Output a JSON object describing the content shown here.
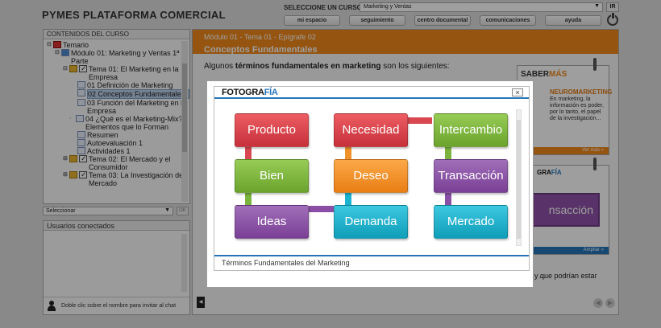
{
  "app": {
    "title": "PYMES PLATAFORMA COMERCIAL",
    "course_select_label": "SELECCIONE UN CURSO:",
    "course_selected": "Marketing y Ventas",
    "go_button": "IR",
    "nav": [
      "mi espacio",
      "seguimiento",
      "centro documental",
      "comunicaciones",
      "ayuda"
    ]
  },
  "sidebar": {
    "header": "CONTENIDOS DEL CURSO",
    "tree": [
      {
        "label": "Temario"
      },
      {
        "label": "Módulo 01: Marketing y Ventas 1ª Parte"
      },
      {
        "label": "Tema 01: El Marketing en la Empresa"
      },
      {
        "label": "01 Definición de Marketing"
      },
      {
        "label": "02 Conceptos Fundamentales"
      },
      {
        "label": "03 Función del Marketing en la Empresa"
      },
      {
        "label": "04 ¿Qué es el Marketing-Mix? Elementos que lo Forman"
      },
      {
        "label": "Resumen"
      },
      {
        "label": "Autoevaluación 1"
      },
      {
        "label": "Actividades 1"
      },
      {
        "label": "Tema 02: El Mercado y el Consumidor"
      },
      {
        "label": "Tema 03: La Investigación de Mercado"
      }
    ],
    "select_placeholder": "Seleccionar",
    "ok_button": "OK",
    "users_header": "Usuarios conectados",
    "users_hint": "Doble clic sobre el nombre para invitar al chat"
  },
  "content": {
    "breadcrumb": "Módulo 01 - Tema 01 - Epígrafe 02",
    "title": "Conceptos Fundamentales",
    "intro_prefix": "Algunos ",
    "intro_bold": "términos fundamentales en marketing",
    "intro_suffix": " son los siguientes:",
    "tail_text_a": "...",
    "tail_text_b": "y que podrían estar",
    "saber_mas": {
      "logo_a": "SABER",
      "logo_b": "MÁS",
      "title": "NEUROMARKETING",
      "text": "En marketing, la información es poder, por lo tanto, el papel de la investigación...",
      "more": "Ver más »"
    },
    "foto_mini": {
      "logo_a": "GRA",
      "logo_b": "FÍA",
      "text": "nsacción",
      "more": "Ampliar »"
    }
  },
  "modal": {
    "logo_a": "FOTOGRA",
    "logo_b": "FÍA",
    "close": "×",
    "caption": "Términos Fundamentales del Marketing",
    "nodes": {
      "producto": "Producto",
      "necesidad": "Necesidad",
      "intercambio": "Intercambio",
      "bien": "Bien",
      "deseo": "Deseo",
      "transaccion": "Transacción",
      "ideas": "Ideas",
      "demanda": "Demanda",
      "mercado": "Mercado"
    }
  },
  "colors": {
    "accent_orange": "#f08a1c",
    "accent_blue": "#2574b8",
    "red": "#d94850",
    "green": "#7ab43c",
    "orange": "#f0922a",
    "purple": "#8a4fa4",
    "cyan": "#1bb3cf"
  }
}
